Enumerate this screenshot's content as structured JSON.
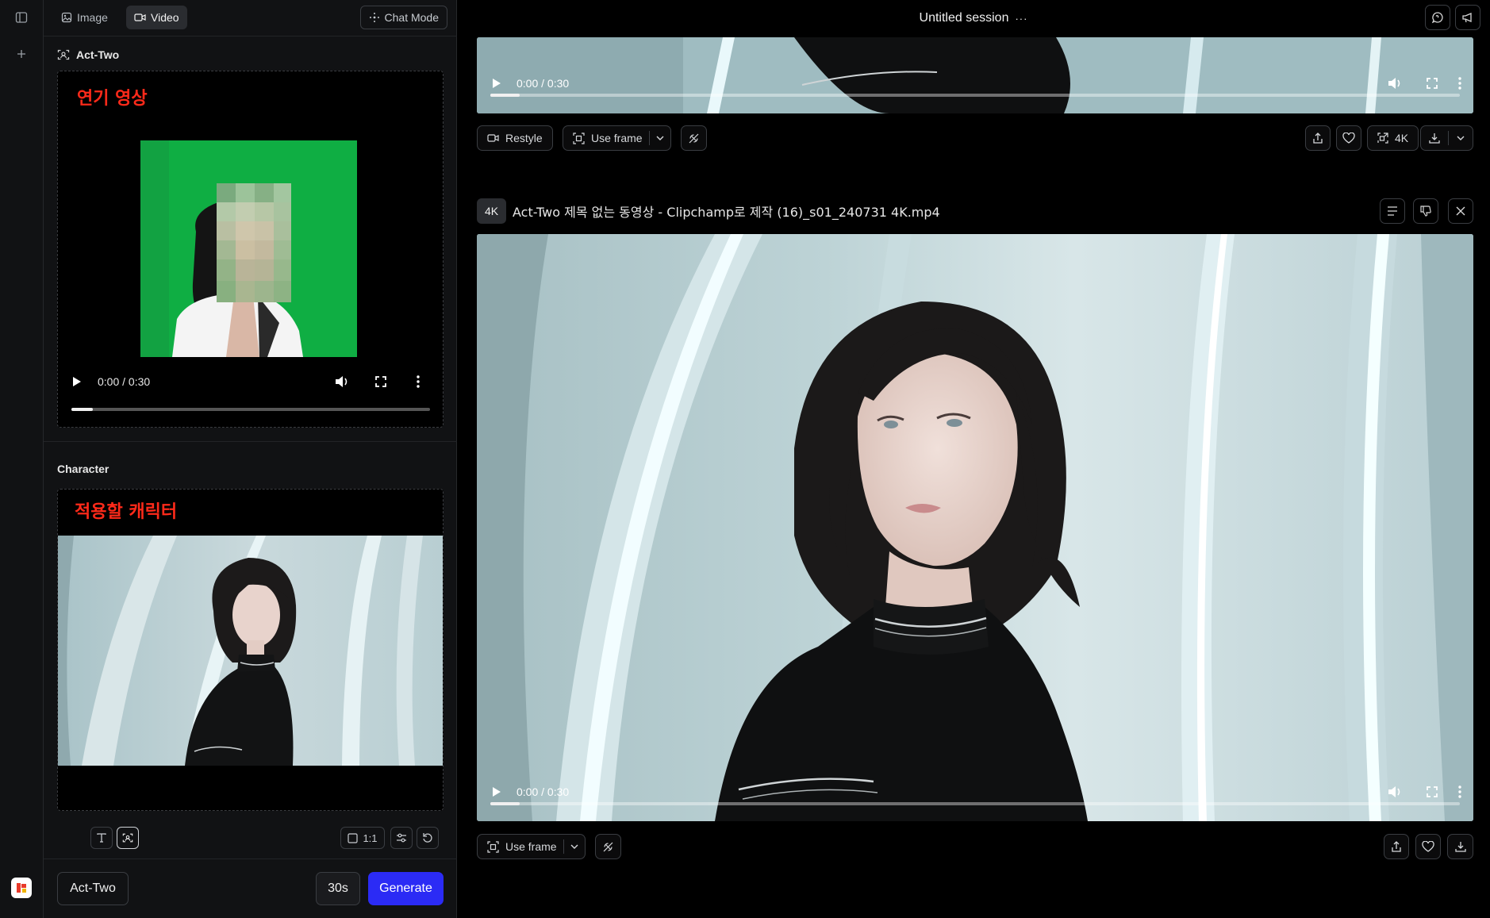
{
  "left_tabs": {
    "image": "Image",
    "video": "Video",
    "chat_mode": "Chat Mode"
  },
  "act_two": {
    "title": "Act-Two",
    "performance_label": "연기 영상",
    "time": "0:00 / 0:30",
    "progress": 0.06
  },
  "character": {
    "title": "Character",
    "label": "적용할 캐릭터"
  },
  "toolbar": {
    "ratio": "1:1"
  },
  "bottom": {
    "model": "Act-Two",
    "duration": "30s",
    "generate": "Generate"
  },
  "session": {
    "title": "Untitled session",
    "more": "···"
  },
  "top_video": {
    "time": "0:00 / 0:30",
    "progress": 0.03,
    "actions": {
      "restyle": "Restyle",
      "use_frame": "Use frame",
      "upscale": "4K"
    }
  },
  "main_video": {
    "badge": "4K",
    "title": "Act-Two 제목 없는 동영상 - Clipchamp로 제작 (16)_s01_240731 4K.mp4",
    "time": "0:00 / 0:30",
    "progress": 0.03,
    "actions": {
      "use_frame": "Use frame"
    }
  },
  "colors": {
    "accent": "#2b2bf5",
    "annotation": "#ff2a1a",
    "greenscreen": "#0fae43"
  }
}
